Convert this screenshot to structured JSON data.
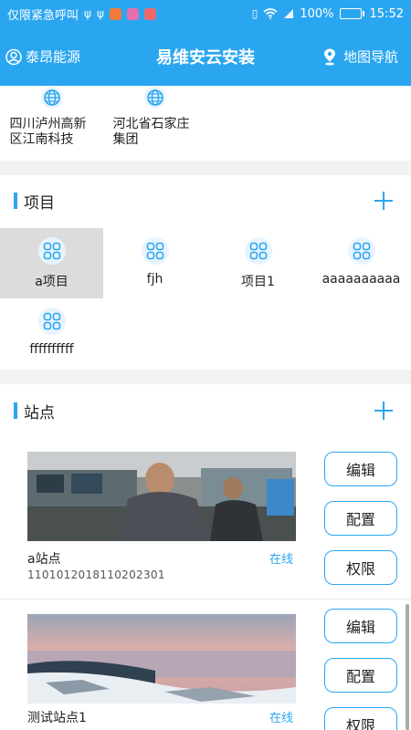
{
  "status_bar": {
    "carrier_text": "仅限紧急呼叫",
    "battery": "100%",
    "time": "15:52",
    "battery_level": 1.0
  },
  "app_bar": {
    "user_label": "泰昂能源",
    "title": "易维安云安装",
    "nav_label": "地图导航"
  },
  "companies": [
    {
      "name": "四川泸州高新区江南科技",
      "icon": "globe-icon"
    },
    {
      "name": "河北省石家庄集团",
      "icon": "globe-icon"
    }
  ],
  "projects_section": {
    "label": "项目",
    "items": [
      "a项目",
      "fjh",
      "项目1",
      "aaaaaaaaaa",
      "ffffffffff"
    ],
    "selected_index": 0
  },
  "sites_section": {
    "label": "站点",
    "items": [
      {
        "name": "a站点",
        "code": "1101012018110202301",
        "status": "在线"
      },
      {
        "name": "测试站点1",
        "code": "",
        "status": "在线"
      }
    ],
    "buttons": {
      "edit": "编辑",
      "config": "配置",
      "permission": "权限"
    }
  },
  "colors": {
    "primary": "#2aa6f0",
    "divider": "#f2f2f2",
    "selected_bg": "#dcdcdc"
  }
}
